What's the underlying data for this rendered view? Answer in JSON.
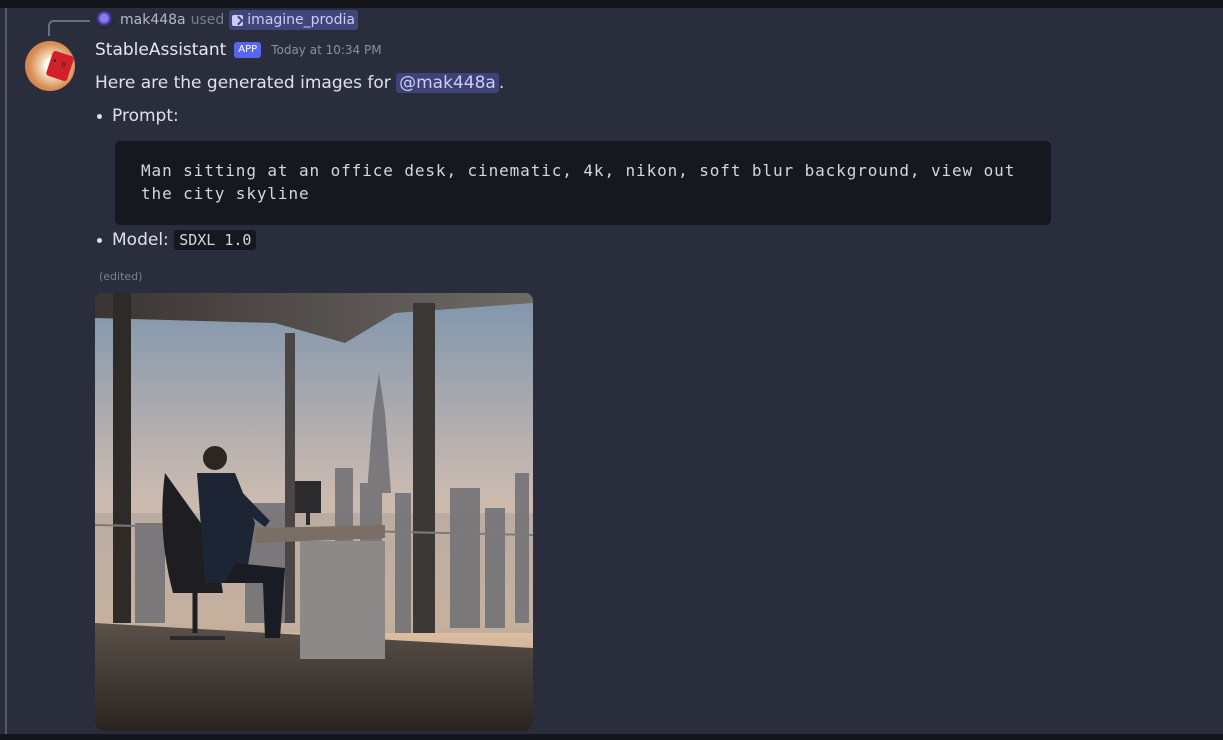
{
  "reply": {
    "user": "mak448a",
    "used": "used",
    "command": "imagine_prodia"
  },
  "message": {
    "author": "StableAssistant",
    "badge": "APP",
    "timestamp": "Today at 10:34 PM",
    "intro": "Here are the generated images for ",
    "mention": "@mak448a",
    "intro_end": ".",
    "prompt_label": "Prompt:",
    "prompt_text": "Man sitting at an office desk, cinematic, 4k, nikon, soft blur background, view out the city skyline",
    "model_label": "Model: ",
    "model_value": "SDXL 1.0",
    "edited": "(edited)"
  },
  "image": {
    "subject": "man-at-office-desk-city-skyline"
  }
}
